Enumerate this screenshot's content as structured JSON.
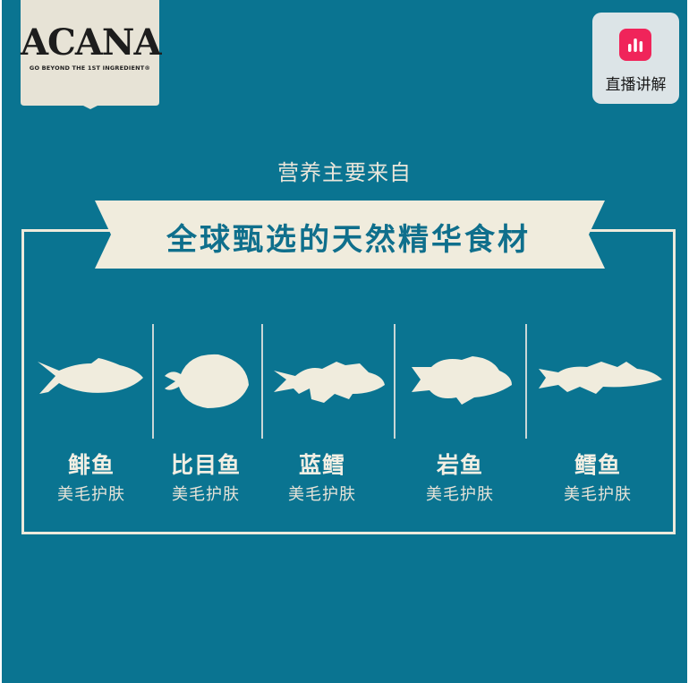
{
  "brand": {
    "logo_text": "ACANA",
    "tagline": "GO BEYOND THE 1ST INGREDIENT®"
  },
  "live_button": {
    "label": "直播讲解",
    "icon": "live-bars-icon",
    "icon_color": "#f0245a"
  },
  "headline": {
    "subtitle": "营养主要来自",
    "banner_title": "全球甄选的天然精华食材"
  },
  "ingredients": [
    {
      "name": "鲱鱼",
      "benefit": "美毛护肤",
      "icon": "herring-icon"
    },
    {
      "name": "比目鱼",
      "benefit": "美毛护肤",
      "icon": "flounder-icon"
    },
    {
      "name": "蓝鳕",
      "benefit": "美毛护肤",
      "icon": "blue-whiting-icon"
    },
    {
      "name": "岩鱼",
      "benefit": "美毛护肤",
      "icon": "rockfish-icon"
    },
    {
      "name": "鳕鱼",
      "benefit": "美毛护肤",
      "icon": "cod-icon"
    }
  ],
  "colors": {
    "background": "#0a7491",
    "cream": "#f0ecdd",
    "banner_text": "#0f6f8c"
  }
}
